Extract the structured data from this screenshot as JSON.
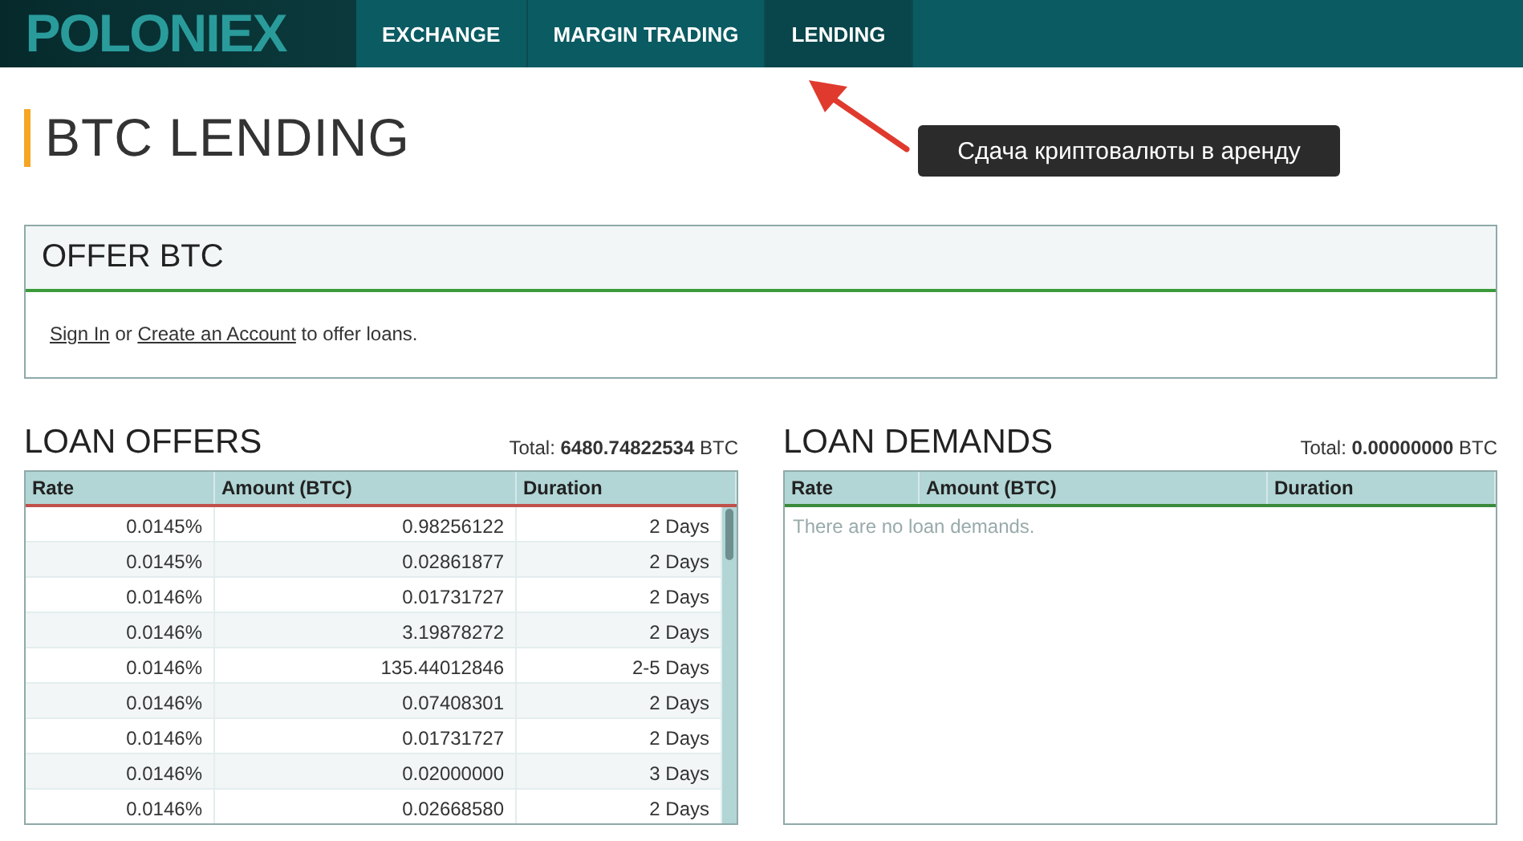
{
  "header": {
    "logo": "POLONIEX",
    "nav": [
      {
        "label": "EXCHANGE",
        "selected": false
      },
      {
        "label": "MARGIN TRADING",
        "selected": false
      },
      {
        "label": "LENDING",
        "selected": true
      }
    ]
  },
  "annotation": {
    "text": "Сдача криптовалюты в аренду"
  },
  "page_title": "BTC LENDING",
  "offer_panel": {
    "title": "OFFER BTC",
    "sign_in": "Sign In",
    "or": "or",
    "create_account": "Create an Account",
    "suffix": "to offer loans."
  },
  "loan_offers": {
    "title": "LOAN OFFERS",
    "total_label": "Total:",
    "total_value": "6480.74822534",
    "total_unit": "BTC",
    "columns": [
      "Rate",
      "Amount (BTC)",
      "Duration"
    ],
    "rows": [
      [
        "0.0145%",
        "0.98256122",
        "2 Days"
      ],
      [
        "0.0145%",
        "0.02861877",
        "2 Days"
      ],
      [
        "0.0146%",
        "0.01731727",
        "2 Days"
      ],
      [
        "0.0146%",
        "3.19878272",
        "2 Days"
      ],
      [
        "0.0146%",
        "135.44012846",
        "2-5 Days"
      ],
      [
        "0.0146%",
        "0.07408301",
        "2 Days"
      ],
      [
        "0.0146%",
        "0.01731727",
        "2 Days"
      ],
      [
        "0.0146%",
        "0.02000000",
        "3 Days"
      ],
      [
        "0.0146%",
        "0.02668580",
        "2 Days"
      ]
    ]
  },
  "loan_demands": {
    "title": "LOAN DEMANDS",
    "total_label": "Total:",
    "total_value": "0.00000000",
    "total_unit": "BTC",
    "columns": [
      "Rate",
      "Amount (BTC)",
      "Duration"
    ],
    "empty_message": "There are no loan demands."
  }
}
